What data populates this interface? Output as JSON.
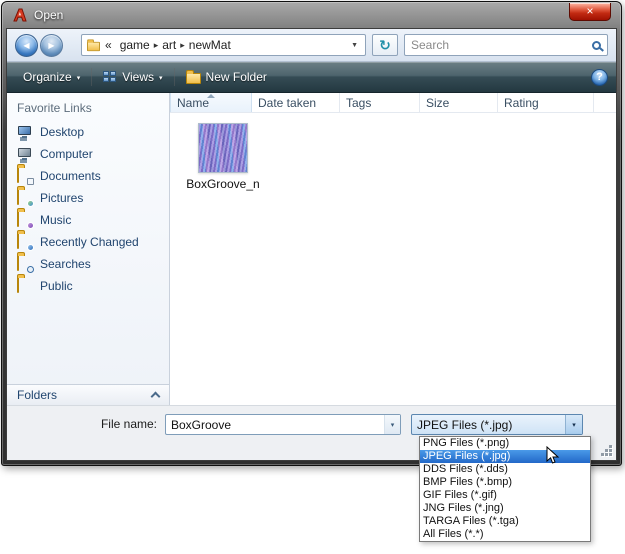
{
  "glyphs": {
    "back": "◀",
    "forward": "▶",
    "collapsed": "«",
    "separator": "▸",
    "triangle_down": "▼",
    "caret_down": "▾",
    "refresh": "↻",
    "close": "×",
    "help": "?"
  },
  "window": {
    "title": "Open"
  },
  "nav": {
    "breadcrumb": {
      "items": [
        "game",
        "art",
        "newMat"
      ]
    },
    "search_placeholder": "Search"
  },
  "toolbar": {
    "organize_label": "Organize",
    "views_label": "Views",
    "new_folder_label": "New Folder"
  },
  "sidebar": {
    "header": "Favorite Links",
    "items": [
      {
        "label": "Desktop",
        "icon": "desktop-icon"
      },
      {
        "label": "Computer",
        "icon": "computer-icon"
      },
      {
        "label": "Documents",
        "icon": "documents-folder-icon"
      },
      {
        "label": "Pictures",
        "icon": "pictures-folder-icon"
      },
      {
        "label": "Music",
        "icon": "music-folder-icon"
      },
      {
        "label": "Recently Changed",
        "icon": "recently-changed-icon"
      },
      {
        "label": "Searches",
        "icon": "searches-icon"
      },
      {
        "label": "Public",
        "icon": "public-folder-icon"
      }
    ],
    "folders_label": "Folders"
  },
  "file_list": {
    "columns": [
      "Name",
      "Date taken",
      "Tags",
      "Size",
      "Rating"
    ],
    "sorted_column": "Name",
    "files": [
      {
        "name": "BoxGroove_n"
      }
    ]
  },
  "footer": {
    "file_name_label": "File name:",
    "file_name_value": "BoxGroove",
    "file_type_value": "JPEG Files (*.jpg)"
  },
  "file_type_dropdown": {
    "selected": "JPEG Files (*.jpg)",
    "options": [
      "PNG Files (*.png)",
      "JPEG Files (*.jpg)",
      "DDS Files (*.dds)",
      "BMP Files (*.bmp)",
      "GIF Files (*.gif)",
      "JNG Files (*.jng)",
      "TARGA Files (*.tga)",
      "All Files (*.*)"
    ]
  }
}
